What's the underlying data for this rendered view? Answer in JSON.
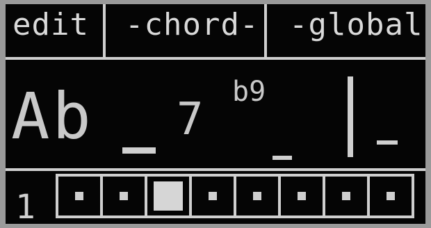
{
  "menu": {
    "edit_label": "edit",
    "chord_label": "-chord-",
    "global_label": "-global-"
  },
  "chord": {
    "root": "Ab",
    "quality": "7",
    "extension": "b9"
  },
  "sequence": {
    "row_number": "1",
    "step_count": 8,
    "active_step": 3
  },
  "colors": {
    "screen_bg": "#050505",
    "pixel_on": "#d8d8d8",
    "bezel": "#9a9a9a"
  }
}
